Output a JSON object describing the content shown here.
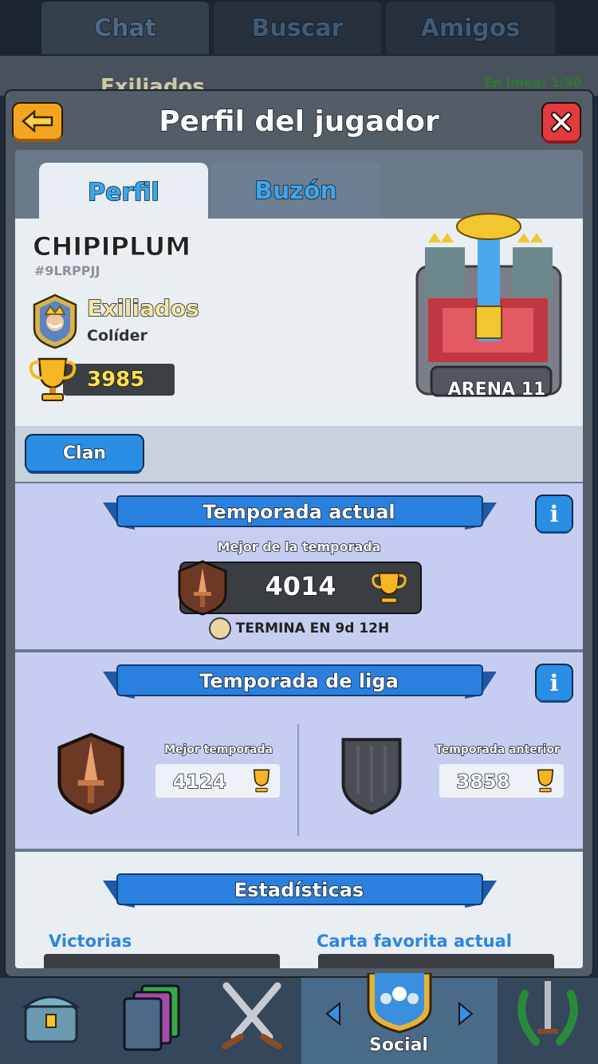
{
  "top_tabs": [
    "Chat",
    "Buscar",
    "Amigos"
  ],
  "behind": {
    "clan": "Exiliados",
    "online": "En línea: 1/50"
  },
  "header": {
    "title": "Perfil del jugador"
  },
  "panel_tabs": [
    "Perfil",
    "Buzón"
  ],
  "profile": {
    "name": "CHIPIPLUM",
    "tag": "#9LRPPJJ",
    "clan_name": "Exiliados",
    "clan_role": "Colíder",
    "trophies": "3985",
    "arena": "ARENA 11",
    "clan_button": "Clan"
  },
  "season": {
    "title": "Temporada actual",
    "best_label": "Mejor de la temporada",
    "best_value": "4014",
    "ends": "TERMINA EN 9d 12H"
  },
  "league": {
    "title": "Temporada de liga",
    "best_label": "Mejor temporada",
    "best_value": "4124",
    "prev_label": "Temporada anterior",
    "prev_value": "3858"
  },
  "stats": {
    "title": "Estadísticas",
    "victorias": "Victorias",
    "fav_card": "Carta favorita actual"
  },
  "nav": {
    "social": "Social"
  },
  "icons": [
    "back-arrow-icon",
    "close-icon",
    "trophy-icon",
    "sword-badge-icon",
    "info-icon",
    "clock-icon",
    "clan-badge-icon"
  ],
  "colors": {
    "accent_blue": "#2a8fe4",
    "gold": "#ffe04a",
    "close_red": "#e23a3e",
    "back_orange": "#f4a51f"
  }
}
